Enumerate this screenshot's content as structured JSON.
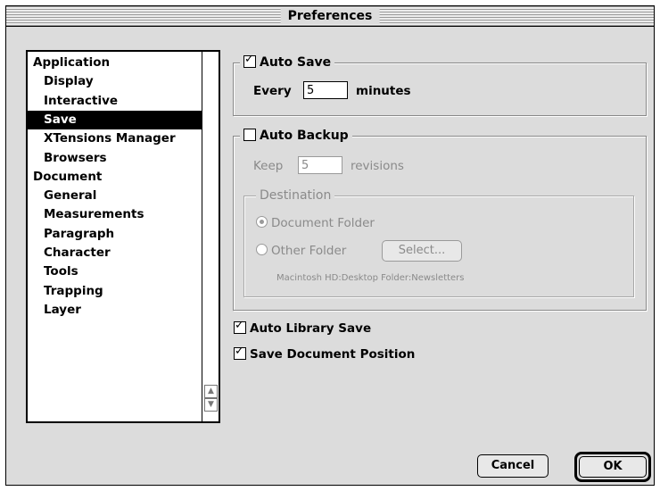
{
  "window": {
    "title": "Preferences"
  },
  "sidebar": {
    "items": [
      {
        "label": "Application",
        "level": "top",
        "selected": false
      },
      {
        "label": "Display",
        "level": "sub",
        "selected": false
      },
      {
        "label": "Interactive",
        "level": "sub",
        "selected": false
      },
      {
        "label": "Save",
        "level": "sub",
        "selected": true
      },
      {
        "label": "XTensions Manager",
        "level": "sub",
        "selected": false
      },
      {
        "label": "Browsers",
        "level": "sub",
        "selected": false
      },
      {
        "label": "Document",
        "level": "top",
        "selected": false
      },
      {
        "label": "General",
        "level": "sub",
        "selected": false
      },
      {
        "label": "Measurements",
        "level": "sub",
        "selected": false
      },
      {
        "label": "Paragraph",
        "level": "sub",
        "selected": false
      },
      {
        "label": "Character",
        "level": "sub",
        "selected": false
      },
      {
        "label": "Tools",
        "level": "sub",
        "selected": false
      },
      {
        "label": "Trapping",
        "level": "sub",
        "selected": false
      },
      {
        "label": "Layer",
        "level": "sub",
        "selected": false
      }
    ]
  },
  "auto_save": {
    "label": "Auto Save",
    "checked": true,
    "every_label": "Every",
    "value": "5",
    "unit_label": "minutes"
  },
  "auto_backup": {
    "label": "Auto Backup",
    "checked": false,
    "keep_label": "Keep",
    "value": "5",
    "unit_label": "revisions",
    "destination": {
      "label": "Destination",
      "document_folder": "Document Folder",
      "other_folder": "Other Folder",
      "select_button": "Select...",
      "path": "Macintosh HD:Desktop Folder:Newsletters"
    }
  },
  "auto_library_save": {
    "label": "Auto Library Save",
    "checked": true
  },
  "save_document_position": {
    "label": "Save Document Position",
    "checked": true
  },
  "buttons": {
    "cancel": "Cancel",
    "ok": "OK"
  },
  "check_glyph": "✓"
}
